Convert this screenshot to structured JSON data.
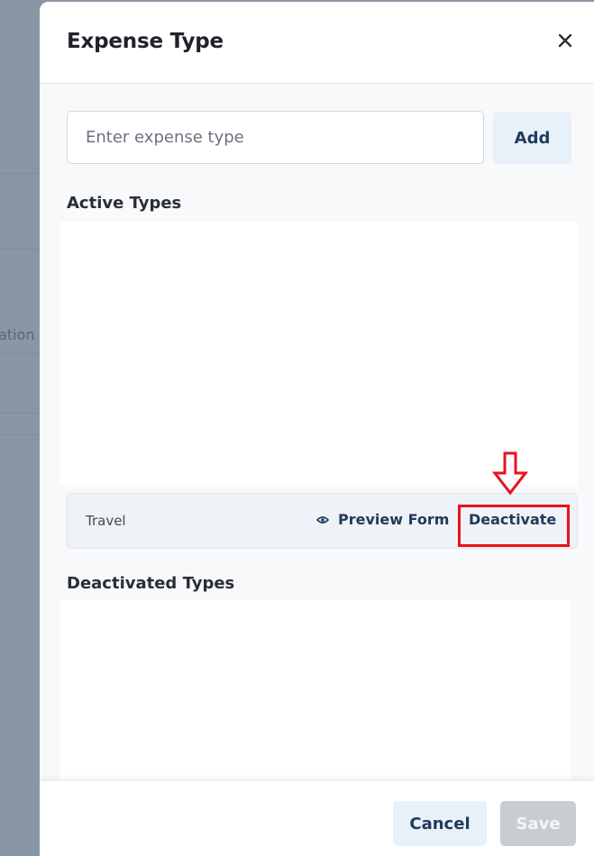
{
  "background": {
    "partial_text": "ation t"
  },
  "modal": {
    "title": "Expense Type",
    "close_icon": "close-icon",
    "input": {
      "placeholder": "Enter expense type",
      "value": ""
    },
    "add_label": "Add",
    "active_section": {
      "heading": "Active Types",
      "items": [
        {
          "name": "Travel",
          "preview_label": "Preview Form",
          "preview_icon": "eye-icon",
          "deactivate_label": "Deactivate"
        }
      ]
    },
    "deactivated_section": {
      "heading": "Deactivated Types",
      "items": []
    },
    "footer": {
      "cancel_label": "Cancel",
      "save_label": "Save"
    }
  },
  "annotation": {
    "highlight_color": "#e8131c",
    "arrow_icon": "down-arrow-icon"
  },
  "colors": {
    "accent_text": "#213a5c",
    "secondary_button_bg": "#e8f0f9",
    "disabled_button_bg": "#c9ccd0"
  }
}
